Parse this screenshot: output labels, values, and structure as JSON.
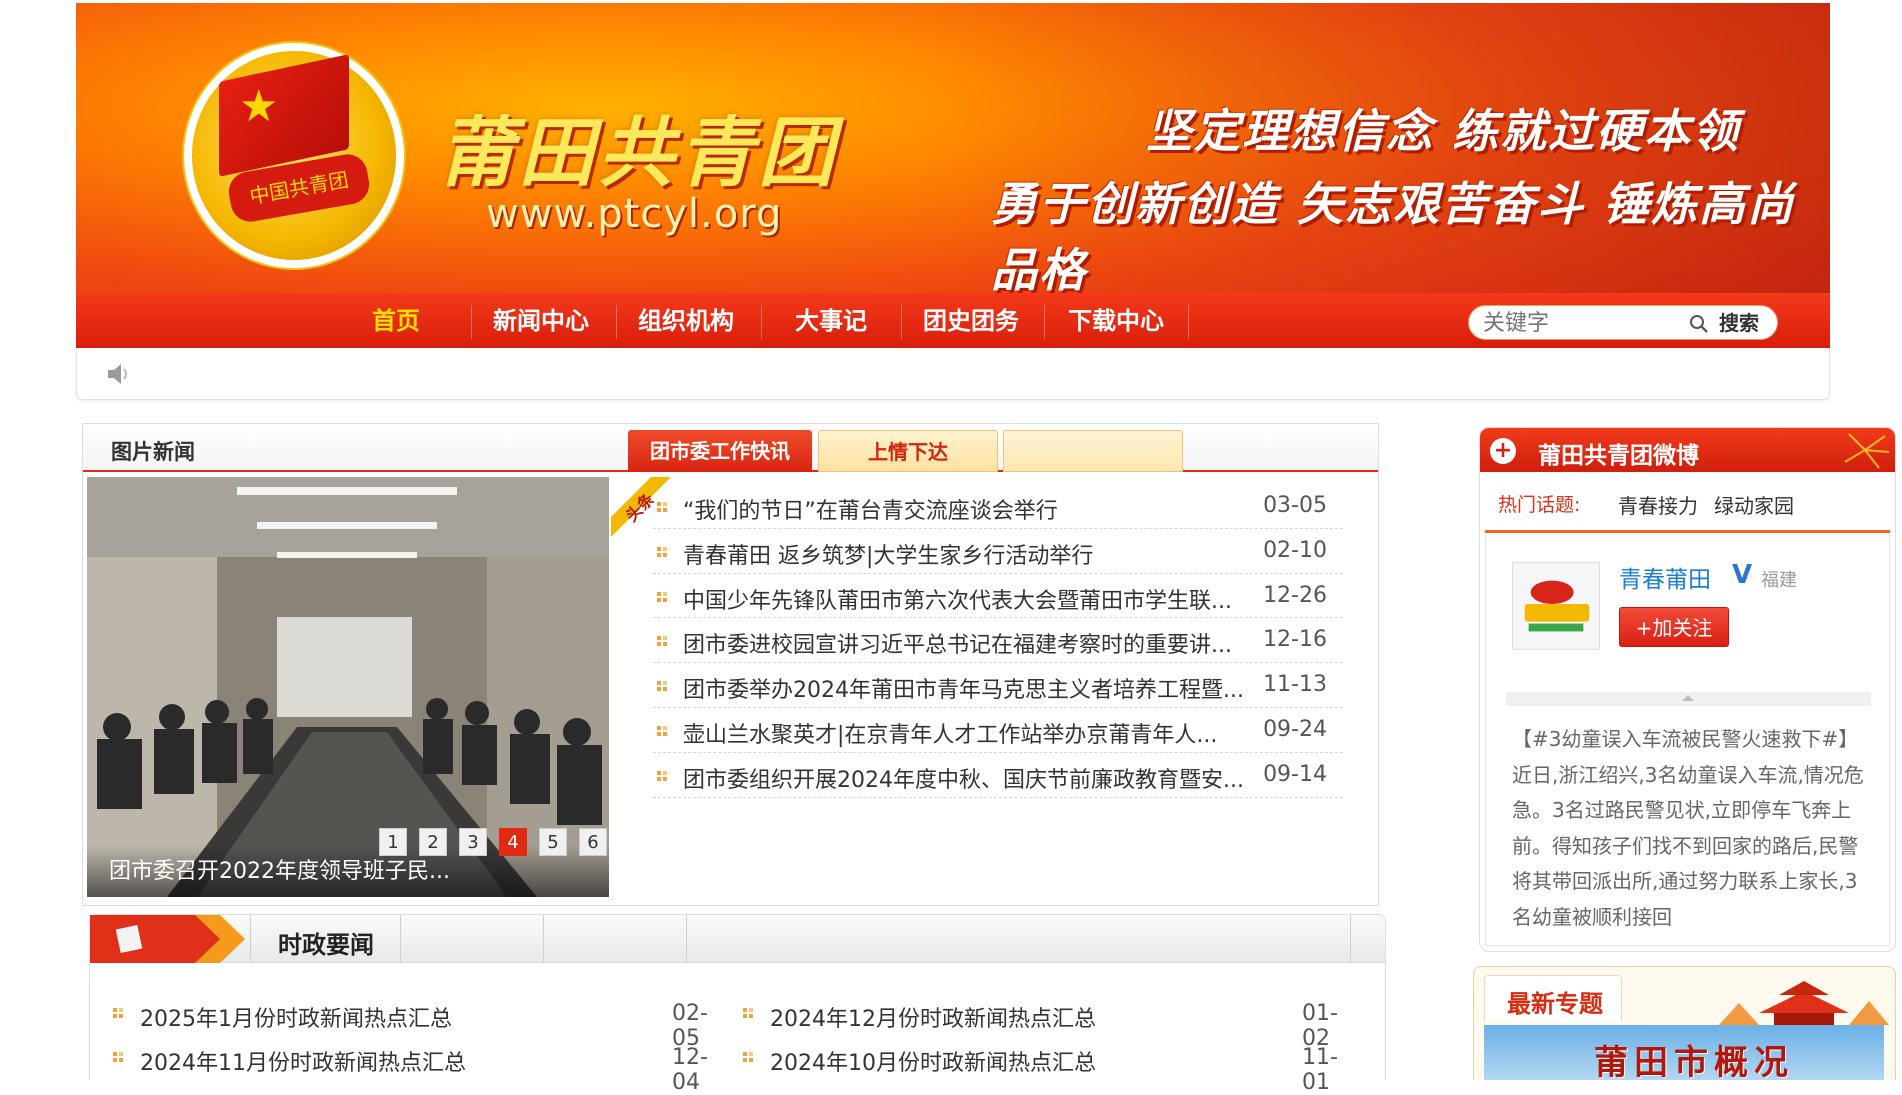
{
  "header": {
    "site_title": "莆田共青团",
    "site_url": "www.ptcyl.org",
    "emblem_text": "中国共青团",
    "slogan_line1": "坚定理想信念 练就过硬本领",
    "slogan_line2": "勇于创新创造 矢志艰苦奋斗 锤炼高尚品格"
  },
  "nav": {
    "items": [
      "首页",
      "新闻中心",
      "组织机构",
      "大事记",
      "团史团务",
      "下载中心"
    ],
    "active_index": 0,
    "search_placeholder": "关键字",
    "search_label": "搜索"
  },
  "picture_news": {
    "title": "图片新闻",
    "caption": "团市委召开2022年度领导班子民...",
    "pages": [
      "1",
      "2",
      "3",
      "4",
      "5",
      "6"
    ],
    "active_page": "4"
  },
  "tabs": [
    "团市委工作快讯",
    "上情下达",
    ""
  ],
  "toutiao_label": "头条",
  "news": [
    {
      "title": "“我们的节日”在莆台青交流座谈会举行",
      "date": "03-05"
    },
    {
      "title": "青春莆田 返乡筑梦|大学生家乡行活动举行",
      "date": "02-10"
    },
    {
      "title": "中国少年先锋队莆田市第六次代表大会暨莆田市学生联...",
      "date": "12-26"
    },
    {
      "title": "团市委进校园宣讲习近平总书记在福建考察时的重要讲...",
      "date": "12-16"
    },
    {
      "title": "团市委举办2024年莆田市青年马克思主义者培养工程暨...",
      "date": "11-13"
    },
    {
      "title": "壶山兰水聚英才|在京青年人才工作站举办京莆青年人...",
      "date": "09-24"
    },
    {
      "title": "团市委组织开展2024年度中秋、国庆节前廉政教育暨安...",
      "date": "09-14"
    }
  ],
  "shizheng": {
    "title": "时政要闻",
    "items": [
      {
        "title": "2025年1月份时政新闻热点汇总",
        "date": "02-05"
      },
      {
        "title": "2024年12月份时政新闻热点汇总",
        "date": "01-02"
      },
      {
        "title": "2024年11月份时政新闻热点汇总",
        "date": "12-04"
      },
      {
        "title": "2024年10月份时政新闻热点汇总",
        "date": "11-01"
      }
    ]
  },
  "weibo": {
    "title": "莆田共青团微博",
    "hot_label": "热门话题:",
    "hot_tags": [
      "青春接力",
      "绿动家园"
    ],
    "account_name": "青春莆田",
    "verified_mark": "V",
    "location": "福建",
    "follow_label": "+加关注",
    "post": "【#3幼童误入车流被民警火速救下#】近日,浙江绍兴,3名幼童误入车流,情况危急。3名过路民警见状,立即停车飞奔上前。得知孩子们找不到回家的路后,民警将其带回派出所,通过努力联系上家长,3名幼童被顺利接回"
  },
  "special": {
    "title": "最新专题",
    "banner_text": "莆田市概况"
  },
  "colors": {
    "brand_red": "#e02a12",
    "nav_active": "#ffe100",
    "link_blue": "#1a7fd4"
  }
}
